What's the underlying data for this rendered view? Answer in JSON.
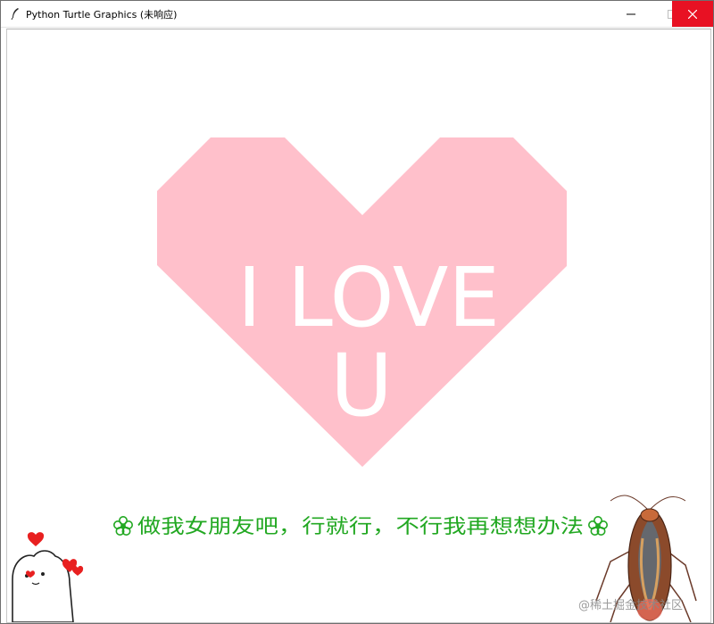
{
  "window": {
    "title": "Python Turtle Graphics (未响应)",
    "controls": {
      "minimize_icon": "minimize-icon",
      "maximize_icon": "maximize-icon",
      "close_icon": "close-icon"
    }
  },
  "canvas": {
    "heart_color": "#ffc0cb",
    "heart_text_line1": "I LOVE",
    "heart_text_line2": "U",
    "heart_text_color": "#ffffff",
    "caption": "做我女朋友吧，行就行，不行我再想想办法",
    "caption_color": "#22a822",
    "flower_icon": "flower-icon"
  },
  "watermark": "@稀土掘金技术社区"
}
